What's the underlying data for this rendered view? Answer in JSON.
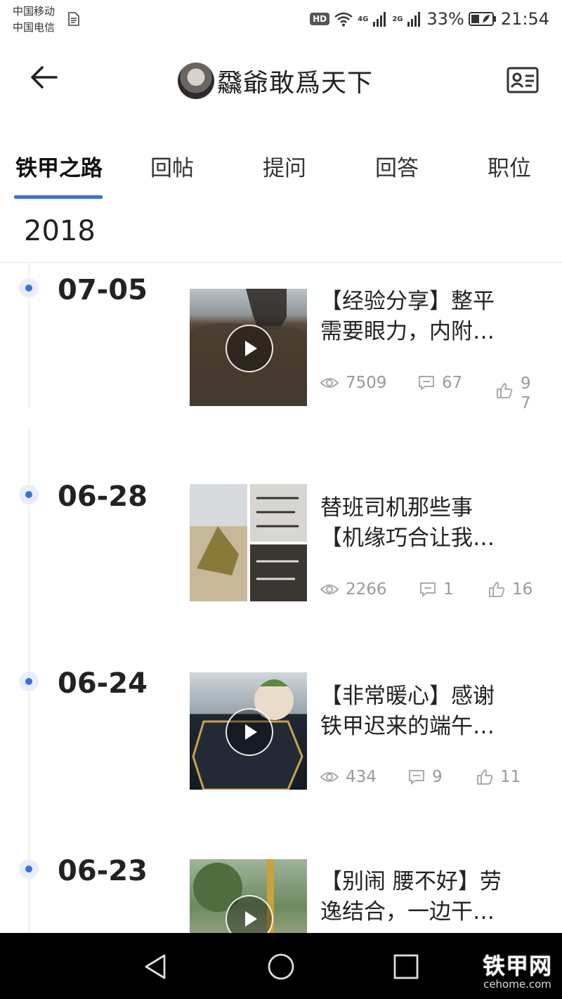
{
  "status_bar": {
    "carrier1": "中国移动",
    "carrier2": "中国电信",
    "hd": "HD",
    "net1": "4G",
    "net2": "2G",
    "battery": "33%",
    "time": "21:54"
  },
  "header": {
    "title": "飝爺敢爲天下",
    "back_icon": "arrow-left-icon",
    "card_icon": "id-card-icon"
  },
  "tabs": [
    {
      "label": "铁甲之路",
      "active": true
    },
    {
      "label": "回帖",
      "active": false
    },
    {
      "label": "提问",
      "active": false
    },
    {
      "label": "回答",
      "active": false
    },
    {
      "label": "职位",
      "active": false
    }
  ],
  "accent_color": "#3b6fe0",
  "year": "2018",
  "posts": [
    {
      "date": "07-05",
      "title_line1": "【经验分享】整平",
      "title_line2": "需要眼力，内附…",
      "views": "7509",
      "comments": "67",
      "likes": "97",
      "likes_digit1": "9",
      "likes_digit2": "7",
      "video": true
    },
    {
      "date": "06-28",
      "title_line1": "替班司机那些事",
      "title_line2": "【机缘巧合让我…",
      "views": "2266",
      "comments": "1",
      "likes": "16",
      "video": false
    },
    {
      "date": "06-24",
      "title_line1": "【非常暖心】感谢",
      "title_line2": "铁甲迟来的端午…",
      "views": "434",
      "comments": "9",
      "likes": "11",
      "video": true
    },
    {
      "date": "06-23",
      "title_line1": "【别闹  腰不好】劳",
      "title_line2": "逸结合，一边干…",
      "video": true
    }
  ],
  "watermark": {
    "main": "铁甲网",
    "sub": "cehome.com"
  }
}
